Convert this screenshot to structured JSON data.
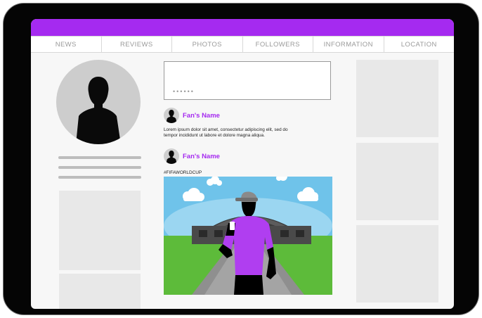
{
  "nav": {
    "items": [
      "NEWS",
      "REVIEWS",
      "PHOTOS",
      "FOLLOWERS",
      "INFORMATION",
      "LOCATION"
    ]
  },
  "composer": {
    "placeholder": "••••••"
  },
  "posts": [
    {
      "author": "Fan's Name",
      "text_line1": "Lorem ipsum dolor sit amet, consectetur adipiscing elit, sed do",
      "text_line2": "tempor incididunt ut labore et dolore magna aliqua."
    },
    {
      "author": "Fan's Name",
      "hashtag": "#FIFAWORLDCUP"
    }
  ],
  "colors": {
    "accent": "#a52af0",
    "device": "#050505",
    "sky": "#6fc3ea",
    "grass": "#5dbb3a",
    "shirt": "#b03ef0"
  },
  "icons": {
    "profile_avatar": "person-silhouette-icon",
    "post_avatar": "person-silhouette-icon"
  }
}
